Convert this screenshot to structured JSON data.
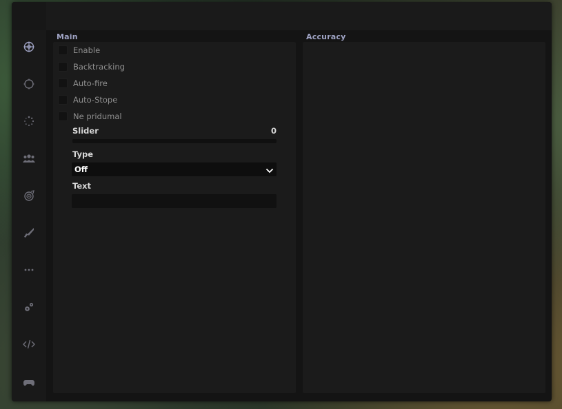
{
  "sidebar": {
    "items": [
      {
        "icon": "crosshair-icon",
        "active": true
      },
      {
        "icon": "circle-icon",
        "active": false
      },
      {
        "icon": "spinner-icon",
        "active": false
      },
      {
        "icon": "group-icon",
        "active": false
      },
      {
        "icon": "eye-target-icon",
        "active": false
      },
      {
        "icon": "rifle-icon",
        "active": false
      },
      {
        "icon": "ellipsis-icon",
        "active": false
      },
      {
        "icon": "gears-icon",
        "active": false
      },
      {
        "icon": "code-icon",
        "active": false
      },
      {
        "icon": "gamepad-icon",
        "active": false
      }
    ]
  },
  "main": {
    "title": "Main",
    "checkboxes": [
      {
        "label": "Enable",
        "checked": false
      },
      {
        "label": "Backtracking",
        "checked": false
      },
      {
        "label": "Auto-fire",
        "checked": false
      },
      {
        "label": "Auto-Stope",
        "checked": false
      },
      {
        "label": "Ne pridumal",
        "checked": false
      }
    ],
    "slider": {
      "label": "Slider",
      "value": "0"
    },
    "type": {
      "label": "Type",
      "value": "Off"
    },
    "text": {
      "label": "Text",
      "value": ""
    }
  },
  "accuracy": {
    "title": "Accuracy"
  },
  "colors": {
    "accent": "#9fa3c4",
    "window": "#141414",
    "panel": "#1b1b1b"
  }
}
